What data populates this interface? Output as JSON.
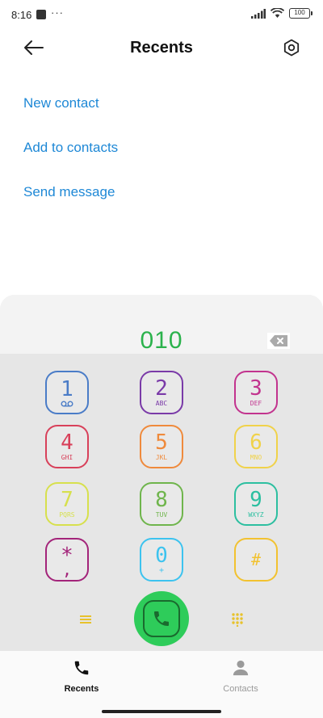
{
  "status_bar": {
    "time": "8:16",
    "dots": "···",
    "battery": "100"
  },
  "header": {
    "title": "Recents"
  },
  "actions": [
    "New contact",
    "Add to contacts",
    "Send message"
  ],
  "dialer": {
    "entered": "010",
    "keys": [
      {
        "num": "1",
        "sub": "",
        "color": "#4a7cc7"
      },
      {
        "num": "2",
        "sub": "ABC",
        "color": "#7a3aa8"
      },
      {
        "num": "3",
        "sub": "DEF",
        "color": "#c2338e"
      },
      {
        "num": "4",
        "sub": "GHI",
        "color": "#d8405a"
      },
      {
        "num": "5",
        "sub": "JKL",
        "color": "#ef8a3c"
      },
      {
        "num": "6",
        "sub": "MNO",
        "color": "#f0d24a"
      },
      {
        "num": "7",
        "sub": "PQRS",
        "color": "#d7e04d"
      },
      {
        "num": "8",
        "sub": "TUV",
        "color": "#6fb54c"
      },
      {
        "num": "9",
        "sub": "WXYZ",
        "color": "#2cbfa0"
      },
      {
        "num": "*",
        "sub": ",",
        "color": "#a3247a"
      },
      {
        "num": "0",
        "sub": "+",
        "color": "#3cc3ef"
      },
      {
        "num": "#",
        "sub": "",
        "color": "#f2c230"
      }
    ],
    "accent": "#2ecc5a"
  },
  "bottom_nav": {
    "recents": "Recents",
    "contacts": "Contacts"
  }
}
